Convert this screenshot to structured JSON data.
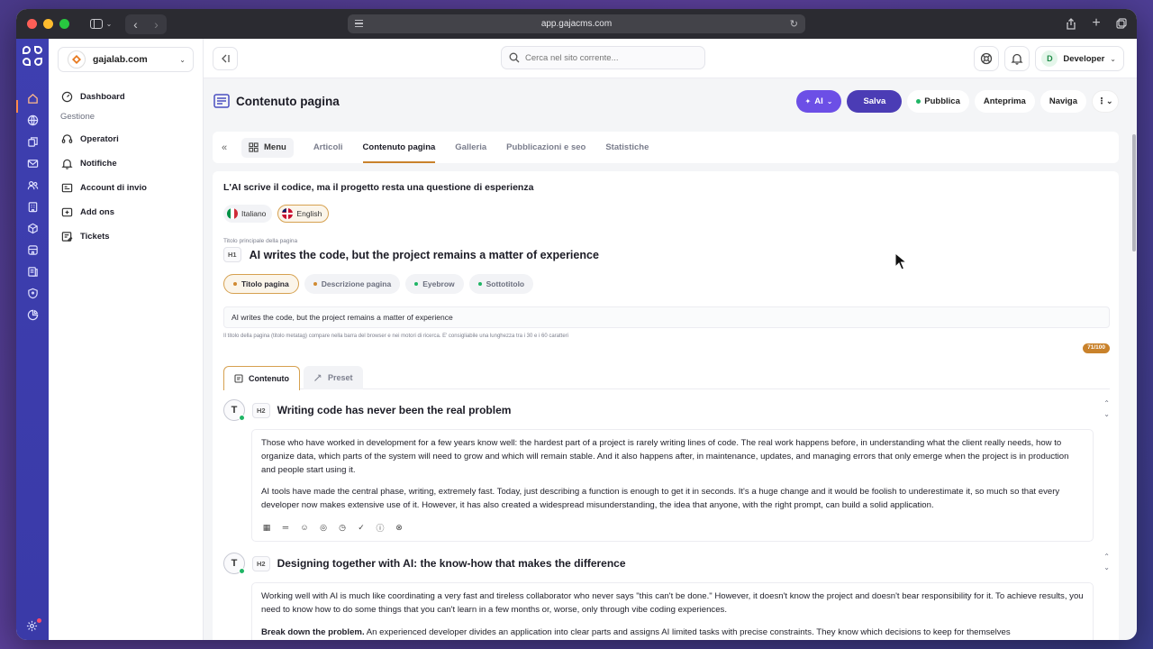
{
  "browser": {
    "url": "app.gajacms.com"
  },
  "sidebar": {
    "site_name": "gajalab.com",
    "dashboard": "Dashboard",
    "section_label": "Gestione",
    "items": [
      {
        "label": "Operatori",
        "icon": "headset-icon"
      },
      {
        "label": "Notifiche",
        "icon": "bell-icon"
      },
      {
        "label": "Account di invio",
        "icon": "mail-account-icon"
      },
      {
        "label": "Add ons",
        "icon": "addons-icon"
      },
      {
        "label": "Tickets",
        "icon": "ticket-icon"
      }
    ]
  },
  "topbar": {
    "search_placeholder": "Cerca nel sito corrente...",
    "user_initial": "D",
    "user_name": "Developer"
  },
  "page": {
    "title": "Contenuto pagina",
    "actions": {
      "ai": "AI",
      "save": "Salva",
      "publish": "Pubblica",
      "preview": "Anteprima",
      "navigate": "Naviga"
    }
  },
  "tabs": {
    "menu": "Menu",
    "items": [
      "Articoli",
      "Contenuto pagina",
      "Galleria",
      "Pubblicazioni e seo",
      "Statistiche"
    ],
    "active": "Contenuto pagina"
  },
  "editor": {
    "article_title": "L'AI scrive il codice, ma il progetto resta una questione di esperienza",
    "languages": [
      {
        "label": "Italiano",
        "active": false
      },
      {
        "label": "English",
        "active": true
      }
    ],
    "h1_label": "Titolo principale della pagina",
    "h1_badge": "H1",
    "h1_text": "AI writes the code, but the project remains a matter of experience",
    "meta_tabs": [
      {
        "label": "Titolo pagina",
        "active": true
      },
      {
        "label": "Descrizione pagina",
        "active": false
      },
      {
        "label": "Eyebrow",
        "active": false
      },
      {
        "label": "Sottotitolo",
        "active": false
      }
    ],
    "meta_value": "AI writes the code, but the project remains a matter of experience",
    "meta_hint": "Il titolo della pagina (titolo metatag) compare nella barra del browser e nei motori di ricerca. E' consigliabile una lunghezza tra i 30 e i 60 caratteri",
    "counter": "71/100",
    "content_tabs": {
      "content": "Contenuto",
      "preset": "Preset"
    },
    "blocks": [
      {
        "badge": "H2",
        "title": "Writing code has never been the real problem",
        "paragraphs": [
          "Those who have worked in development for a few years know well: the hardest part of a project is rarely writing lines of code. The real work happens before, in understanding what the client really needs, how to organize data, which parts of the system will need to grow and which will remain stable. And it also happens after, in maintenance, updates, and managing errors that only emerge when the project is in production and people start using it.",
          "AI tools have made the central phase, writing, extremely fast. Today, just describing a function is enough to get it in seconds. It's a huge change and it would be foolish to underestimate it, so much so that every developer now makes extensive use of it. However, it has also created a widespread misunderstanding, the idea that anyone, with the right prompt, can build a solid application."
        ]
      },
      {
        "badge": "H2",
        "title": "Designing together with AI: the know-how that makes the difference",
        "paragraphs": [
          "Working well with AI is much like coordinating a very fast and tireless collaborator who never says \"this can't be done.\" However, it doesn't know the project and doesn't bear responsibility for it. To achieve results, you need to know how to do some things that you can't learn in a few months or, worse, only through vibe coding experiences."
        ],
        "bold_lead": "Break down the problem.",
        "lead_rest": " An experienced developer divides an application into clear parts and assigns AI limited tasks with precise constraints. They know which decisions to keep for themselves"
      }
    ]
  },
  "colors": {
    "accent_purple": "#4b3cb5",
    "ai_purple": "#6c4fe6",
    "accent_orange": "#c9822b",
    "rail": "#3e3fb0"
  }
}
